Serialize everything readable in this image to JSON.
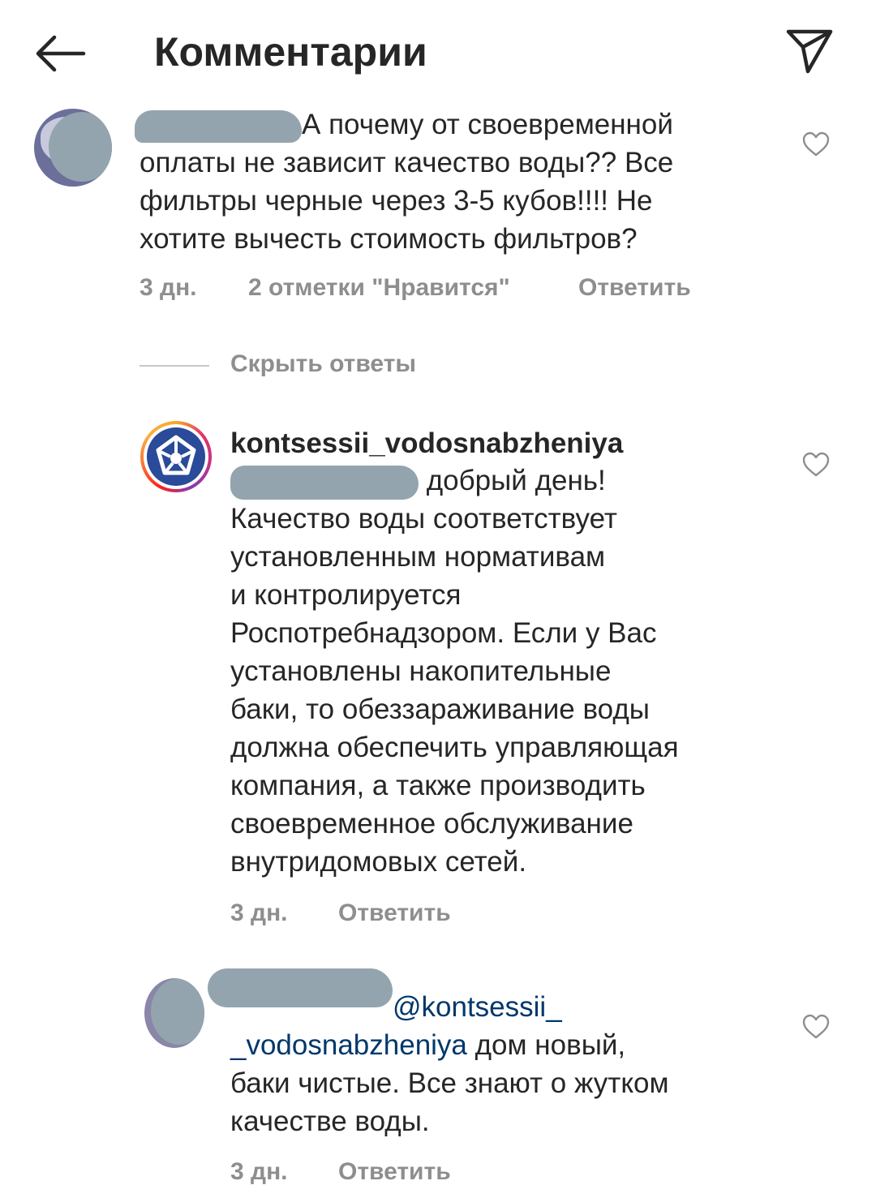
{
  "header": {
    "title": "Комментарии",
    "back_icon": "arrow-left-icon",
    "share_icon": "paper-plane-icon"
  },
  "comment1": {
    "text_lines": [
      "А почему от своевременной",
      "оплаты не зависит качество воды?? Все",
      "фильтры черные через 3-5 кубов!!!! Не",
      "хотите вычесть стоимость фильтров?"
    ],
    "time": "3 дн.",
    "likes": "2 отметки \"Нравится\"",
    "reply": "Ответить"
  },
  "replies_toggle": {
    "label": "Скрыть ответы"
  },
  "reply1": {
    "username": "kontsessii_vodosnabzheniya",
    "text_lines": [
      "добрый день!",
      "Качество воды соответствует",
      "установленным нормативам",
      "и контролируется",
      "Роспотребнадзором. Если у Вас",
      "установлены накопительные",
      "баки, то обеззараживание воды",
      "должна обеспечить управляющая",
      "компания, а также производить",
      "своевременное обслуживание",
      "внутридомовых сетей."
    ],
    "time": "3 дн.",
    "reply": "Ответить"
  },
  "reply2": {
    "mention_line1": "@kontsessii_",
    "mention_line2": "_vodosnabzheniya",
    "text_after_mention": " дом новый,",
    "text_lines": [
      "баки чистые. Все знают о жутком",
      "качестве воды."
    ],
    "time": "3 дн.",
    "reply": "Ответить"
  },
  "colors": {
    "text": "#262626",
    "meta": "#8e8e8e",
    "mention": "#00376b",
    "redacted": "#93a4ae",
    "brand_blue": "#2a4a9a"
  }
}
